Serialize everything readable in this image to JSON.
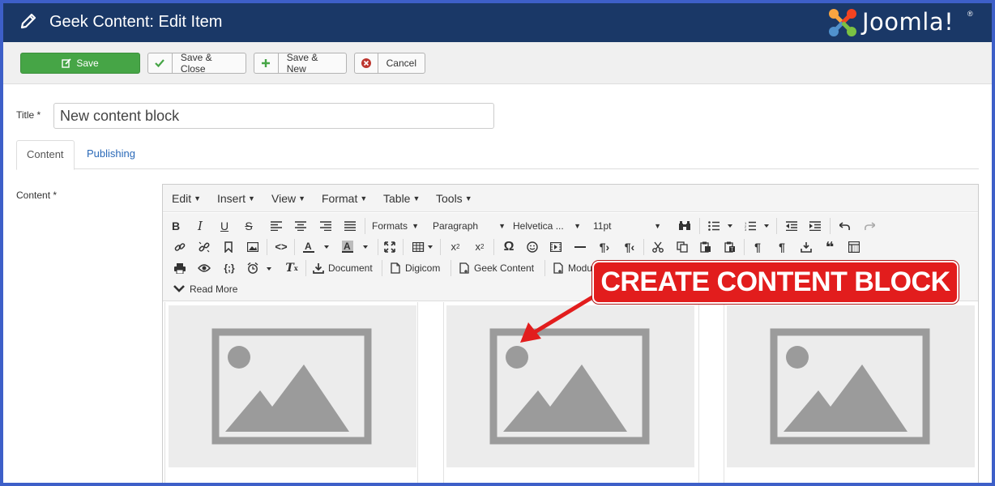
{
  "header": {
    "title": "Geek Content: Edit Item",
    "brand": "Joomla!",
    "brand_mark": "Joomla",
    "brand_reg": "®"
  },
  "toolbar": {
    "save_label": "Save",
    "save_close_label": "Save & Close",
    "save_new_label": "Save & New",
    "cancel_label": "Cancel"
  },
  "form": {
    "title_label": "Title *",
    "title_value": "New content block",
    "content_label": "Content *"
  },
  "tabs": [
    {
      "label": "Content",
      "active": true
    },
    {
      "label": "Publishing",
      "active": false
    }
  ],
  "editor": {
    "menu": [
      "Edit",
      "Insert",
      "View",
      "Format",
      "Table",
      "Tools"
    ],
    "formats_label": "Formats",
    "block_format": "Paragraph",
    "font_family": "Helvetica ...",
    "font_size": "11pt",
    "plugins": {
      "document": "Document",
      "digicom": "Digicom",
      "geek_content": "Geek Content",
      "module": "Modu"
    },
    "read_more": "Read More"
  },
  "callout": {
    "text": "CREATE CONTENT BLOCK"
  },
  "colors": {
    "header_bg": "#1a3867",
    "save_green": "#46a546",
    "callout_red": "#e21d1d",
    "frame_blue": "#3d5fc8"
  }
}
